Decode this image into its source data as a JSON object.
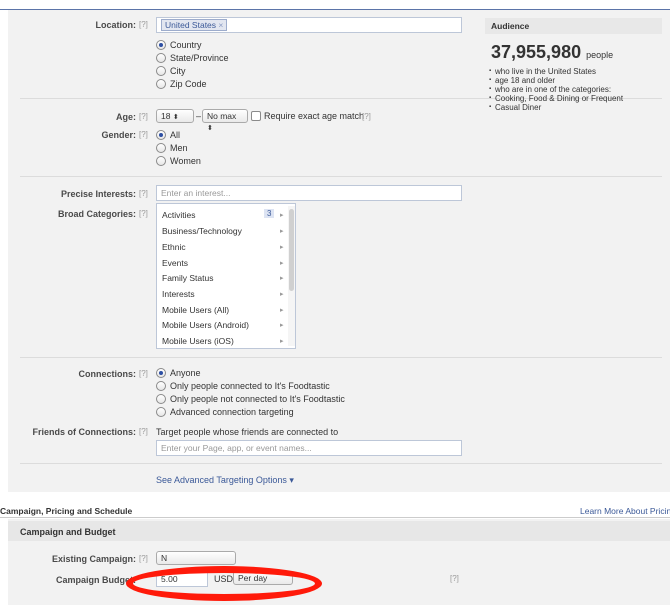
{
  "targeting": {
    "location": {
      "label": "Location:",
      "hint": "[?]",
      "token": "United States",
      "options": [
        "Country",
        "State/Province",
        "City",
        "Zip Code"
      ],
      "selected": "Country"
    },
    "age": {
      "label": "Age:",
      "hint": "[?]",
      "min": "18",
      "dash": "–",
      "max": "No max",
      "exact_label": "Require exact age match",
      "exact_hint": "[?]"
    },
    "gender": {
      "label": "Gender:",
      "hint": "[?]",
      "options": [
        "All",
        "Men",
        "Women"
      ],
      "selected": "All"
    },
    "precise_interests": {
      "label": "Precise Interests:",
      "hint": "[?]",
      "placeholder": "Enter an interest..."
    },
    "broad_categories": {
      "label": "Broad Categories:",
      "hint": "[?]",
      "count": "3",
      "items": [
        "Activities",
        "Business/Technology",
        "Ethnic",
        "Events",
        "Family Status",
        "Interests",
        "Mobile Users (All)",
        "Mobile Users (Android)",
        "Mobile Users (iOS)"
      ]
    },
    "connections": {
      "label": "Connections:",
      "hint": "[?]",
      "options": [
        "Anyone",
        "Only people connected to It's Foodtastic",
        "Only people not connected to It's Foodtastic",
        "Advanced connection targeting"
      ],
      "selected": "Anyone"
    },
    "friends_of_connections": {
      "label": "Friends of Connections:",
      "hint": "[?]",
      "description": "Target people whose friends are connected to",
      "placeholder": "Enter your Page, app, or event names..."
    },
    "advanced_link": "See Advanced Targeting Options ▾"
  },
  "audience": {
    "heading": "Audience",
    "count": "37,955,980",
    "unit": "people",
    "bullets": [
      "who live in the United States",
      "age 18 and older",
      "who are in one of the categories:",
      "Cooking, Food & Dining or Frequent",
      "Casual Diner"
    ]
  },
  "campaign": {
    "section_title": "Campaign, Pricing and Schedule",
    "learn_more": "Learn More About Pricing",
    "subheading": "Campaign and Budget",
    "existing_label": "Existing Campaign:",
    "existing_hint": "[?]",
    "existing_value": "N",
    "budget_label": "Campaign Budget:",
    "budget_value": "5.00",
    "currency": "USD",
    "period": "Per day",
    "budget_hint": "[?]"
  },
  "highlight_color": "#ff1a0a"
}
